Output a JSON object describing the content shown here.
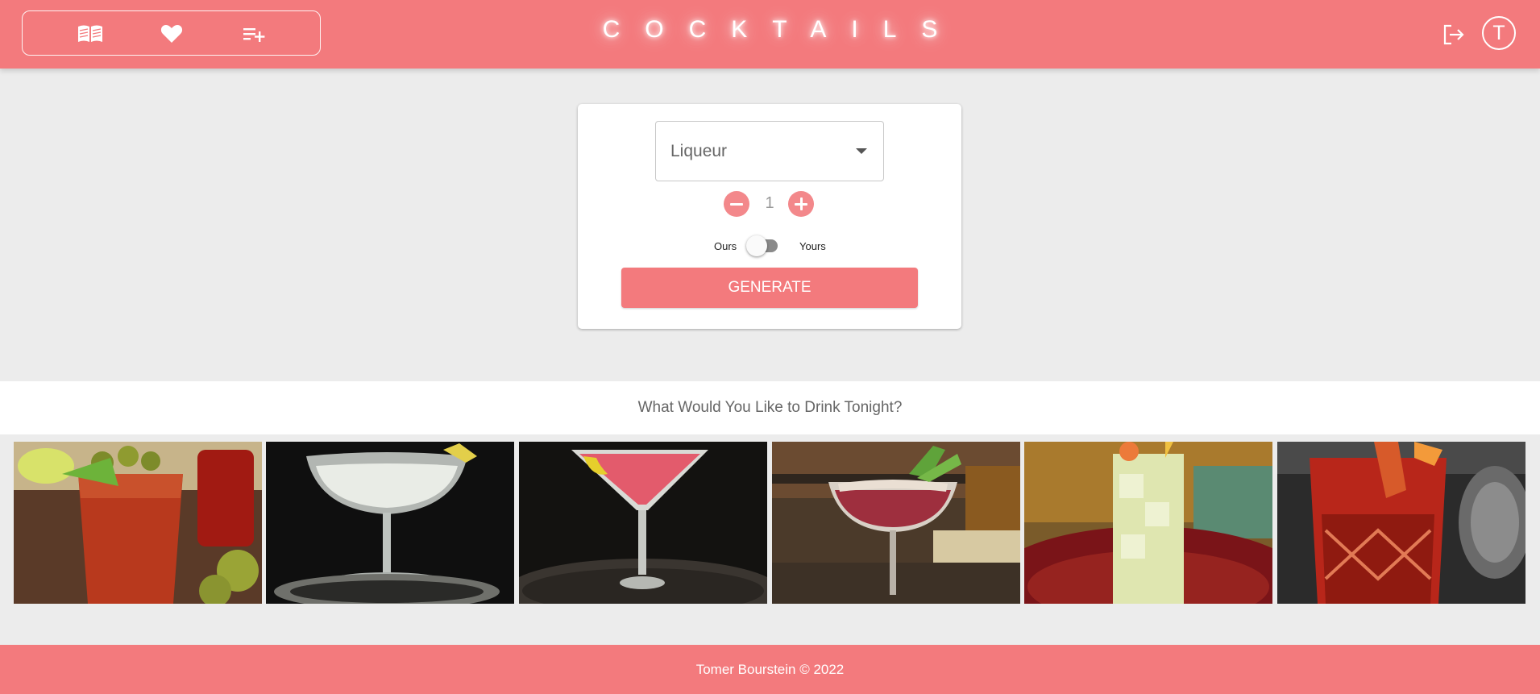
{
  "header": {
    "title": "COCKTAILS",
    "nav_icons": [
      "book-open-icon",
      "heart-icon",
      "playlist-add-icon"
    ],
    "logout_icon": "logout-icon",
    "avatar_letter": "T"
  },
  "generator": {
    "spirit_select_value": "Liqueur",
    "quantity": "1",
    "toggle_left_label": "Ours",
    "toggle_right_label": "Yours",
    "toggle_state": "Ours",
    "generate_label": "GENERATE"
  },
  "gallery": {
    "heading": "What Would You Like to Drink Tonight?",
    "images": [
      "bloody-mary-photo",
      "martini-coupe-photo",
      "pink-cosmopolitan-photo",
      "red-whiskey-sour-photo",
      "lemonade-highball-photo",
      "negroni-rocks-photo"
    ]
  },
  "footer": {
    "text": "Tomer Bourstein © 2022"
  },
  "colors": {
    "brand": "#f37a7d",
    "background": "#ececec",
    "card": "#ffffff"
  }
}
